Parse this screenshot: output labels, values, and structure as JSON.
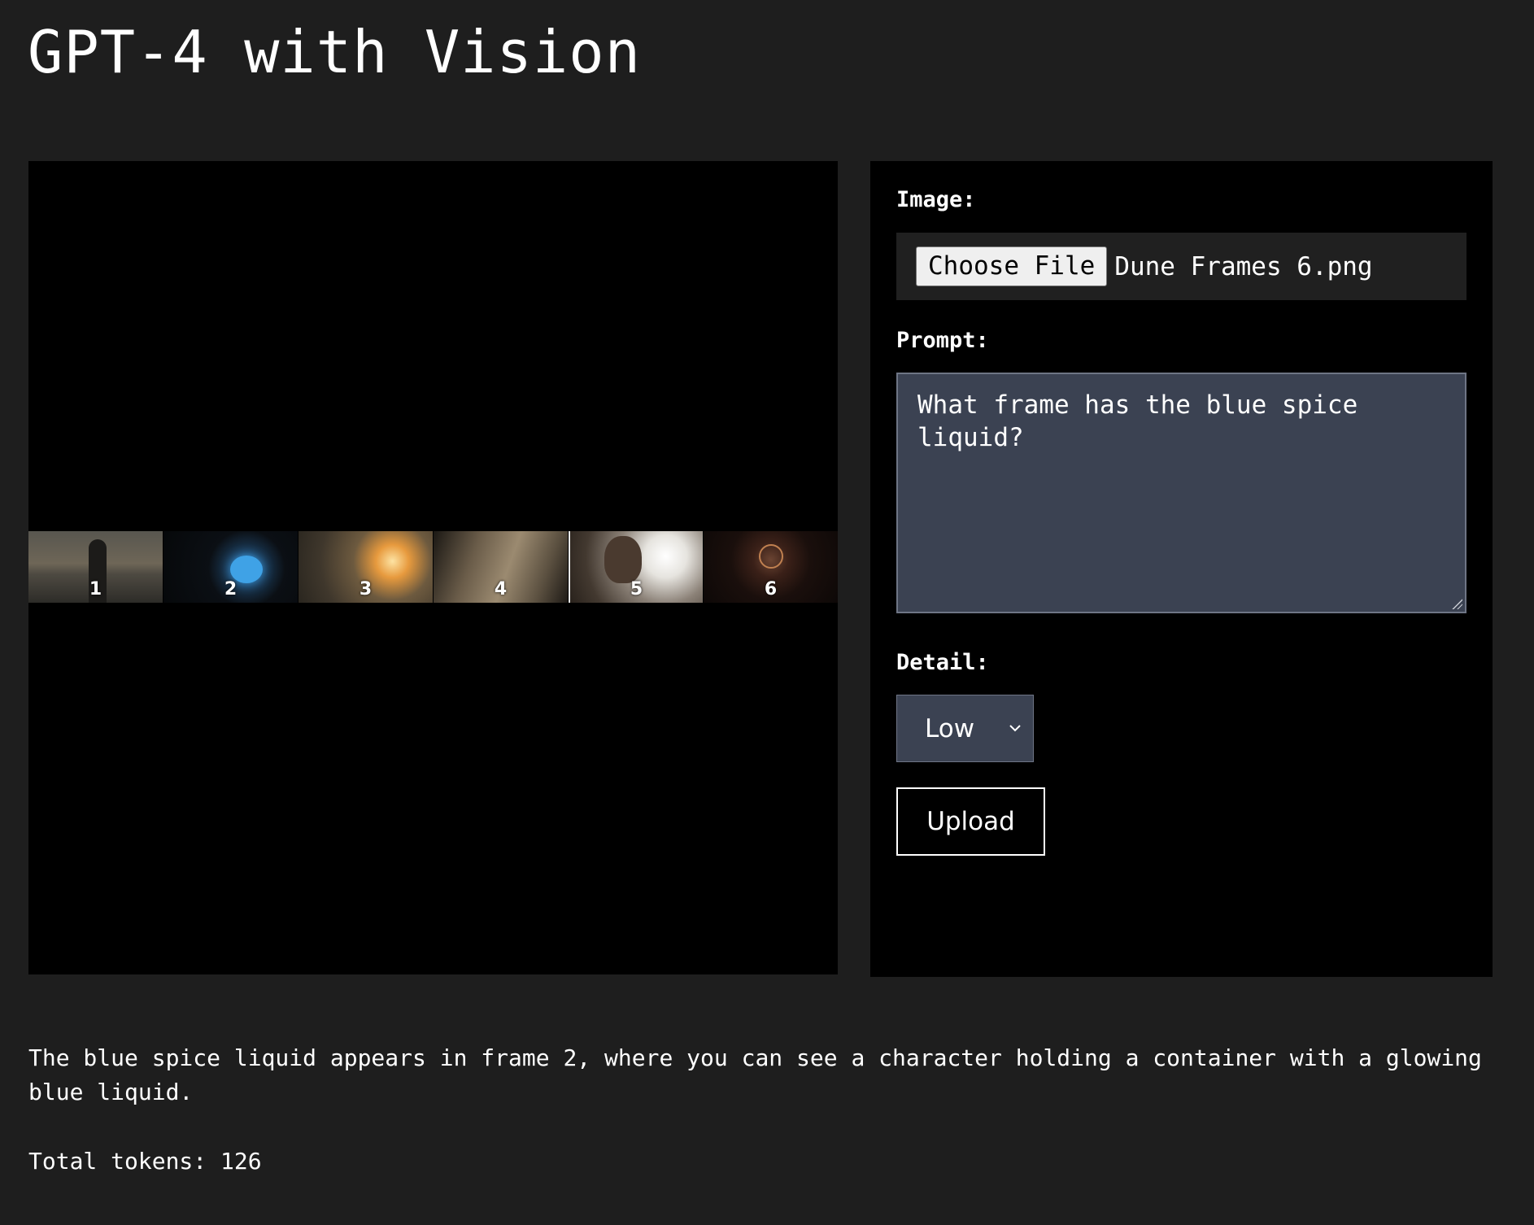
{
  "page": {
    "title": "GPT-4 with Vision"
  },
  "preview": {
    "frames": [
      {
        "number": "1"
      },
      {
        "number": "2"
      },
      {
        "number": "3"
      },
      {
        "number": "4"
      },
      {
        "number": "5"
      },
      {
        "number": "6"
      }
    ]
  },
  "form": {
    "image_label": "Image:",
    "choose_file_label": "Choose File",
    "file_name": "Dune Frames 6.png",
    "prompt_label": "Prompt:",
    "prompt_value": "What frame has the blue spice liquid?",
    "detail_label": "Detail:",
    "detail_value": "Low",
    "upload_label": "Upload"
  },
  "result": {
    "response": "The blue spice liquid appears in frame 2, where you can see a character holding a container with a glowing blue liquid.",
    "total_tokens": "Total tokens: 126"
  },
  "colors": {
    "page_background": "#1e1e1e",
    "panel_background": "#000000",
    "input_background": "#3b4252",
    "text": "#ffffff"
  }
}
